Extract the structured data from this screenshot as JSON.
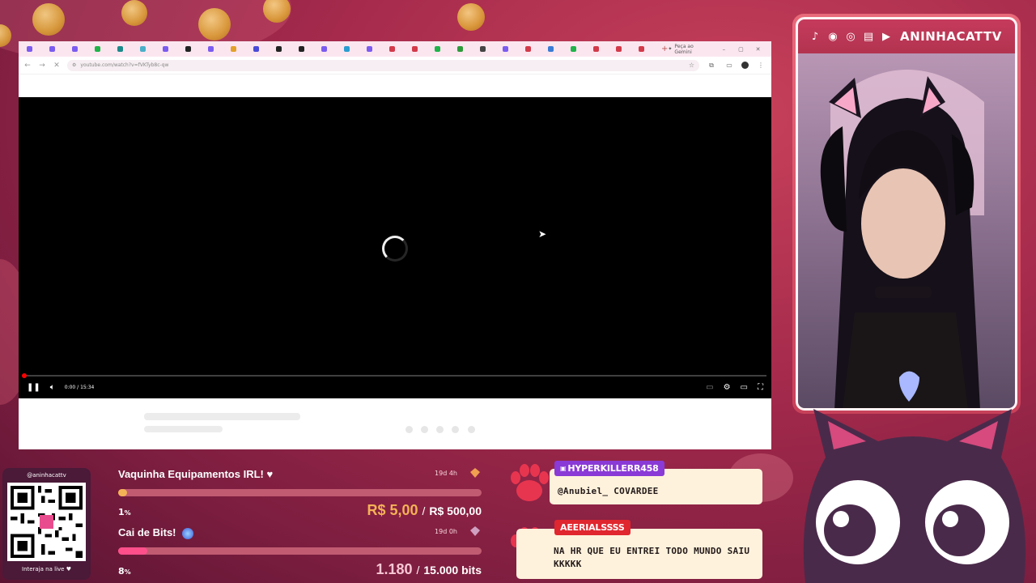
{
  "browser": {
    "url": "youtube.com/watch?v=fVKTyb8c-qw",
    "gemini_label": "Peça ao Gemini",
    "tab_colors": [
      "#7b5cf0",
      "#7b5cf0",
      "#7b5cf0",
      "#1fb34a",
      "#1b8a8a",
      "#4ab0c8",
      "#7b5cf0",
      "#222",
      "#7b5cf0",
      "#e3a12a",
      "#4a4ad8",
      "#222",
      "#222",
      "#7b5cf0",
      "#2a9dd1",
      "#7b5cf0",
      "#d23a4a",
      "#d23a4a",
      "#1fb34a",
      "#2d9a3a",
      "#444",
      "#7b5cf0",
      "#d23a4a",
      "#3a7bd5",
      "#1fb34a",
      "#d23a4a",
      "#d23a4a",
      "#d23a4a"
    ],
    "window_controls": [
      "–",
      "▢",
      "✕"
    ],
    "nav": [
      "←",
      "→",
      "✕"
    ]
  },
  "player": {
    "time": "0:00 / 15:34",
    "icons": [
      "pause-icon",
      "volume-icon",
      "subtitles-icon",
      "settings-icon",
      "theater-icon",
      "fullscreen-icon"
    ]
  },
  "webcam": {
    "handle": "ANINHACATTV",
    "social_icons": [
      "tiktok-icon",
      "discord-icon",
      "instagram-icon",
      "twitch-icon",
      "youtube-icon"
    ]
  },
  "qr": {
    "handle": "@aninhacattv",
    "caption": "Interaja na live ♥"
  },
  "goals": [
    {
      "title": "Vaquinha Equipamentos IRL! ♥",
      "time": "19d 4h",
      "percent": "1",
      "percent_unit": "%",
      "progress": 0.01,
      "current": "R$ 5,00",
      "separator": "/",
      "target": "R$ 500,00",
      "fill_color": "#f4b256",
      "current_color": "#f4b256"
    },
    {
      "title": "Cai de Bits!",
      "time": "19d 0h",
      "percent": "8",
      "percent_unit": "%",
      "progress": 0.08,
      "current": "1.180",
      "separator": "/",
      "target": "15.000 bits",
      "fill_color": "#ff4f8b",
      "current_color": "#f7c6d4"
    }
  ],
  "chat": [
    {
      "username": "HYPERKILLERR458",
      "name_color": "#8a3ad6",
      "has_badge": true,
      "message": "@Anubiel_ COVARDEE"
    },
    {
      "username": "AEERIALSSSS",
      "name_color": "#e0262e",
      "has_badge": false,
      "message": "NA HR QUE EU ENTREI TODO MUNDO SAIU KKKKK"
    }
  ],
  "colors": {
    "accent": "#c63a5c",
    "chat_bg": "#fff2dc",
    "paw": "#e8354f"
  }
}
